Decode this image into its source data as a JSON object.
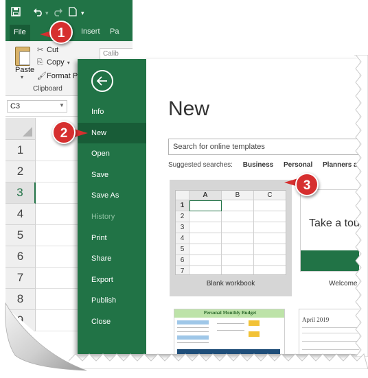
{
  "excel": {
    "tabs": {
      "file": "File",
      "insert": "Insert",
      "page": "Pa"
    },
    "ribbon": {
      "paste": "Paste",
      "cut": "Cut",
      "copy": "Copy",
      "format_painter": "Format Pa",
      "group_clipboard": "Clipboard",
      "font_name": "Calib"
    },
    "name_box": "C3",
    "row_headers": [
      "1",
      "2",
      "3",
      "4",
      "5",
      "6",
      "7",
      "8",
      "9"
    ]
  },
  "backstage": {
    "nav": [
      {
        "label": "Info",
        "state": "normal"
      },
      {
        "label": "New",
        "state": "active"
      },
      {
        "label": "Open",
        "state": "normal"
      },
      {
        "label": "Save",
        "state": "normal"
      },
      {
        "label": "Save As",
        "state": "normal"
      },
      {
        "label": "History",
        "state": "disabled"
      },
      {
        "label": "Print",
        "state": "normal"
      },
      {
        "label": "Share",
        "state": "normal"
      },
      {
        "label": "Export",
        "state": "normal"
      },
      {
        "label": "Publish",
        "state": "normal"
      },
      {
        "label": "Close",
        "state": "normal"
      }
    ],
    "title": "New",
    "search_placeholder": "Search for online templates",
    "suggested_label": "Suggested searches:",
    "suggested": [
      "Business",
      "Personal",
      "Planners and Trac"
    ],
    "templates": {
      "blank": {
        "label": "Blank workbook",
        "columns": [
          "A",
          "B",
          "C"
        ],
        "rows": [
          "1",
          "2",
          "3",
          "4",
          "5",
          "6",
          "7"
        ]
      },
      "tour": {
        "text": "Take a tou",
        "label": "Welcome"
      },
      "budget": {
        "title": "Personal Monthly Budget"
      },
      "calendar": {
        "title": "April 2019"
      }
    }
  },
  "callouts": [
    "1",
    "2",
    "3"
  ],
  "colors": {
    "excel_green": "#217346",
    "excel_green_dark": "#185c37",
    "callout_red": "#d62f2f"
  }
}
